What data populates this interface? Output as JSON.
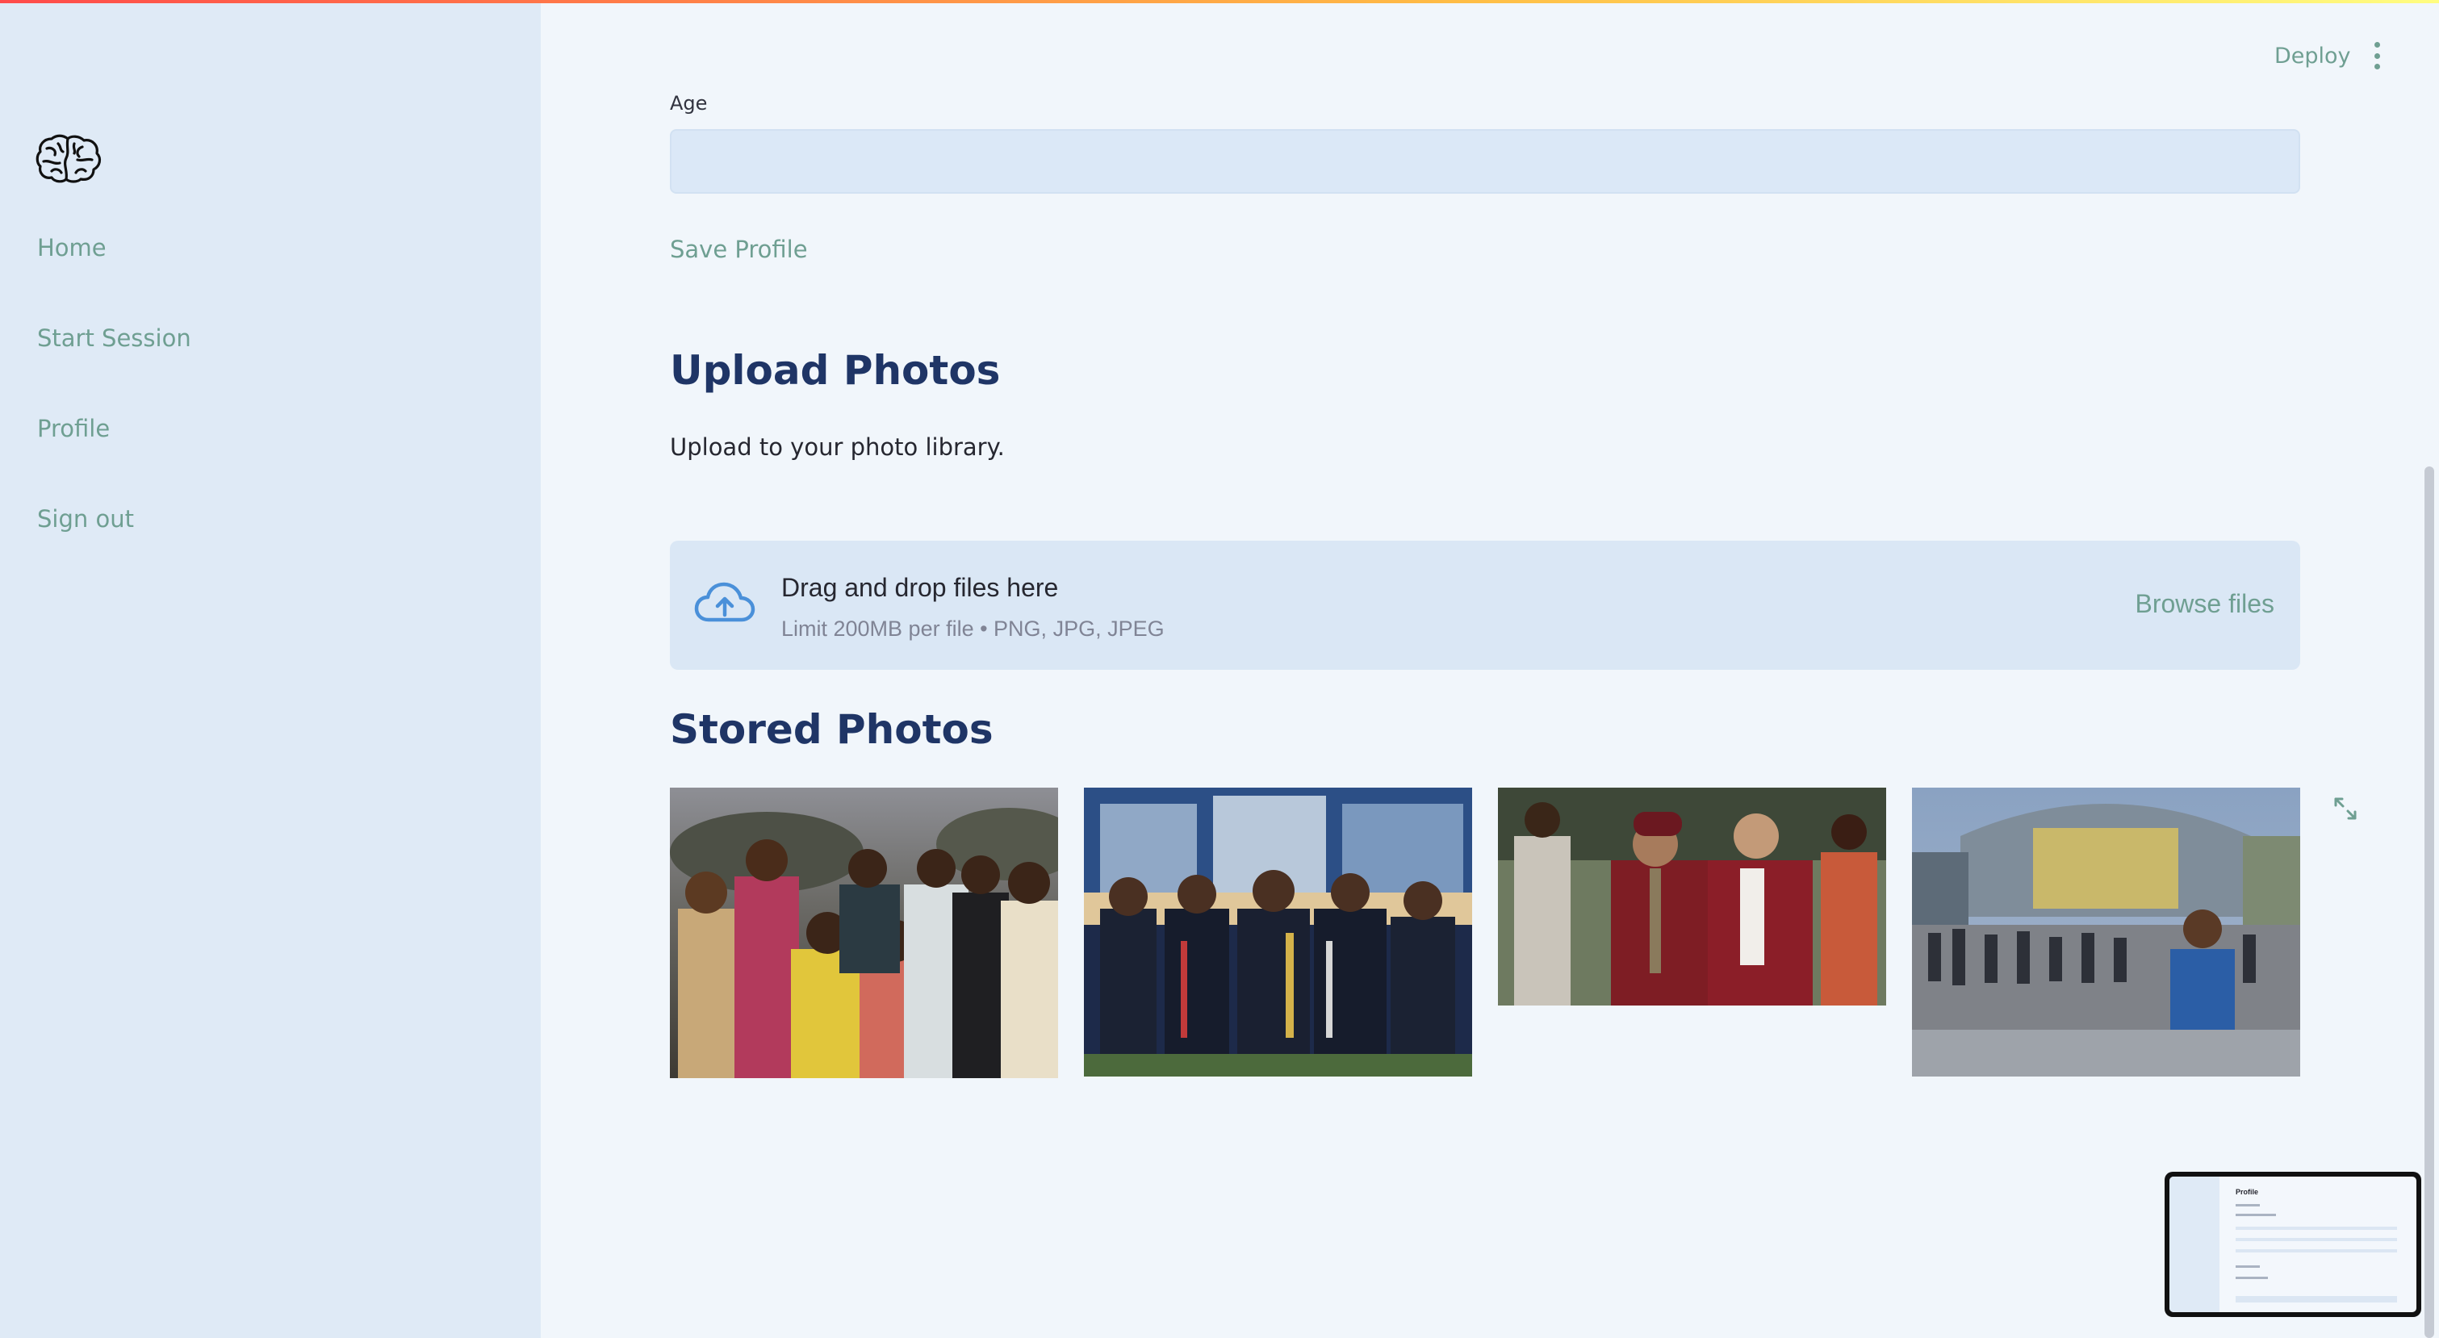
{
  "colors": {
    "background": "#f1f6fb",
    "sidebar": "#dfeaf6",
    "accent": "#6f9f92",
    "heading": "#1f3566",
    "input": "#dbe8f7"
  },
  "sidebar": {
    "logo_icon": "brain-icon",
    "items": [
      {
        "label": "Home"
      },
      {
        "label": "Start Session"
      },
      {
        "label": "Profile"
      },
      {
        "label": "Sign out"
      }
    ]
  },
  "header": {
    "deploy_label": "Deploy",
    "menu_icon": "kebab-menu-icon"
  },
  "profile_form": {
    "age_label": "Age",
    "age_value": "",
    "save_label": "Save Profile"
  },
  "upload": {
    "heading": "Upload Photos",
    "subtitle": "Upload to your photo library.",
    "dropzone": {
      "icon": "cloud-upload-icon",
      "title": "Drag and drop files here",
      "limit": "Limit 200MB per file • PNG, JPG, JPEG",
      "browse_label": "Browse files"
    }
  },
  "stored": {
    "heading": "Stored Photos",
    "expand_icon": "fullscreen-expand-icon",
    "photo_count": 4
  },
  "minimap": {
    "title": "Profile"
  }
}
